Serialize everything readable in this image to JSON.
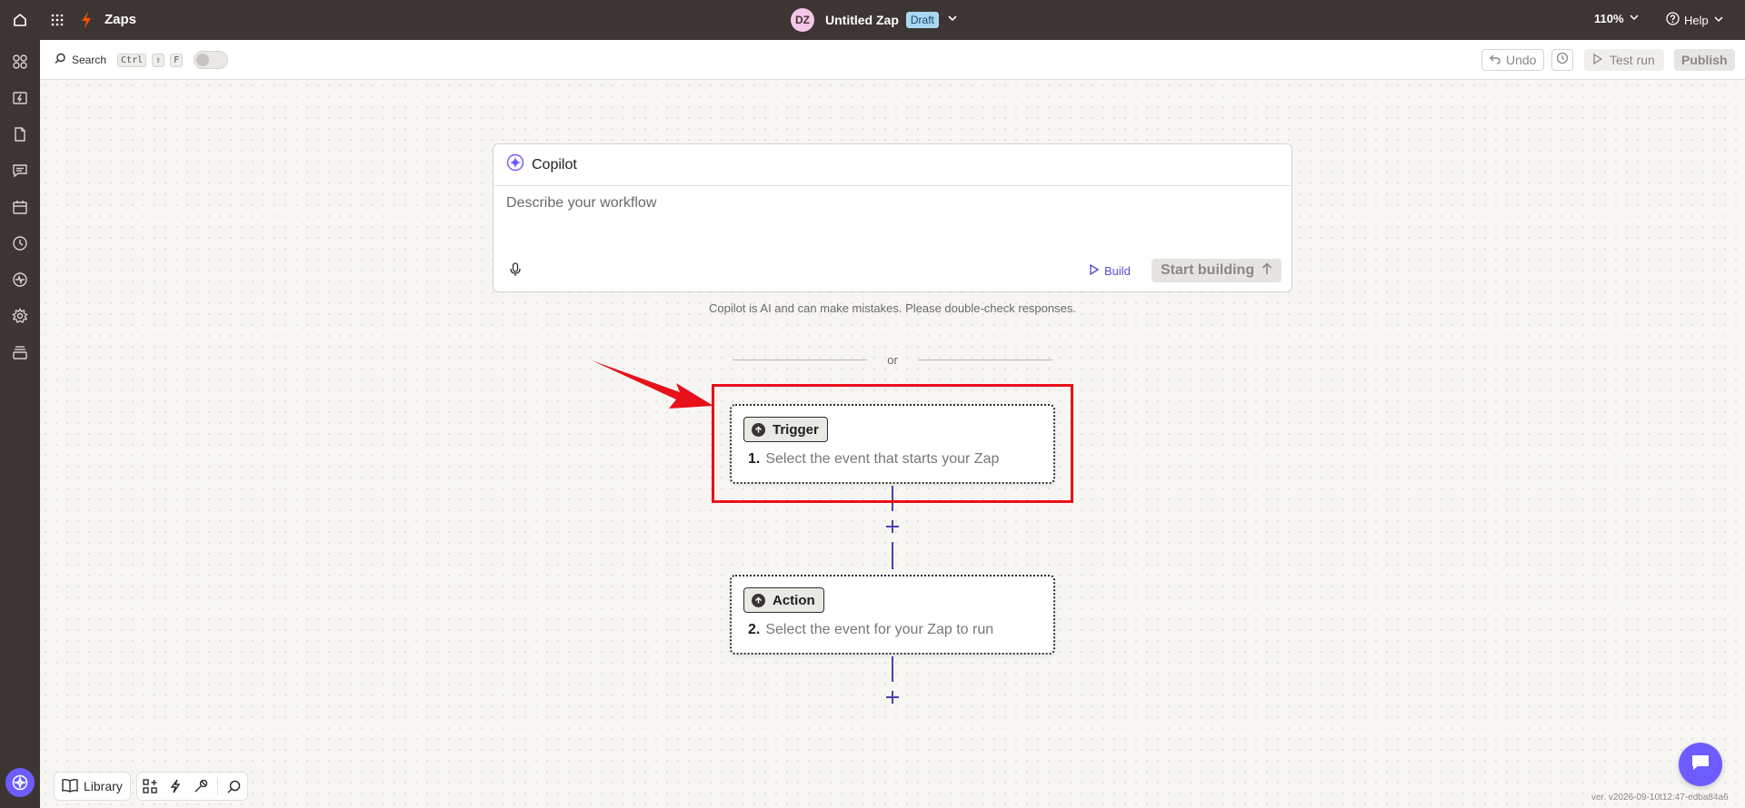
{
  "topbar": {
    "app_name": "Zaps",
    "avatar_initials": "DZ",
    "zap_name": "Untitled Zap",
    "status_badge": "Draft",
    "zoom": "110%",
    "help": "Help"
  },
  "toolbar": {
    "search_label": "Search",
    "shortcut_keys": [
      "Ctrl",
      "⇧",
      "F"
    ],
    "undo_label": "Undo",
    "test_run_label": "Test run",
    "publish_label": "Publish"
  },
  "copilot": {
    "title": "Copilot",
    "placeholder": "Describe your workflow",
    "build_label": "Build",
    "start_label": "Start building",
    "disclaimer": "Copilot is AI and can make mistakes. Please double-check responses."
  },
  "divider_text": "or",
  "steps": [
    {
      "badge": "Trigger",
      "number": "1.",
      "text": "Select the event that starts your Zap"
    },
    {
      "badge": "Action",
      "number": "2.",
      "text": "Select the event for your Zap to run"
    }
  ],
  "bottom": {
    "library_label": "Library"
  },
  "version": "ver. v2026-09-10t12:47-edba84a6",
  "colors": {
    "topbar_bg": "#3d3533",
    "accent": "#6d5cff",
    "highlight": "#e8101a",
    "draft_badge": "#a8d8f0"
  }
}
